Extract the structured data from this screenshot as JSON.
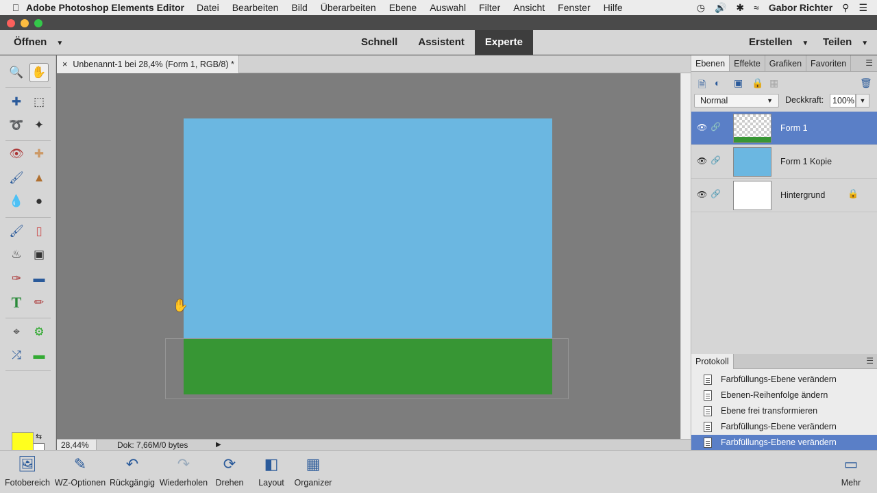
{
  "menubar": {
    "app_name": "Adobe Photoshop Elements Editor",
    "items": [
      "Datei",
      "Bearbeiten",
      "Bild",
      "Überarbeiten",
      "Ebene",
      "Auswahl",
      "Filter",
      "Ansicht",
      "Fenster",
      "Hilfe"
    ],
    "user": "Gabor Richter"
  },
  "modebar": {
    "open_label": "Öffnen",
    "modes": [
      "Schnell",
      "Assistent",
      "Experte"
    ],
    "active_mode": "Experte",
    "create_label": "Erstellen",
    "share_label": "Teilen"
  },
  "document": {
    "tab_close": "×",
    "tab_title": "Unbenannt-1 bei 28,4% (Form 1, RGB/8) *",
    "sky_color": "#6bb7e1",
    "grass_color": "#379634"
  },
  "status": {
    "zoom": "28,44%",
    "doc_info": "Dok: 7,66M/0 bytes"
  },
  "colors": {
    "foreground": "#ffff1e",
    "background": "#ffffff"
  },
  "layers_panel": {
    "tabs": [
      "Ebenen",
      "Effekte",
      "Grafiken",
      "Favoriten"
    ],
    "active_tab": "Ebenen",
    "blend_mode": "Normal",
    "opacity_label": "Deckkraft:",
    "opacity_value": "100%",
    "layers": [
      {
        "name": "Form 1",
        "selected": true
      },
      {
        "name": "Form 1 Kopie",
        "selected": false
      },
      {
        "name": "Hintergrund",
        "selected": false
      }
    ]
  },
  "history_panel": {
    "tab": "Protokoll",
    "items": [
      "Farbfüllungs-Ebene verändern",
      "Ebenen-Reihenfolge ändern",
      "Ebene frei transformieren",
      "Farbfüllungs-Ebene verändern",
      "Farbfüllungs-Ebene verändern"
    ]
  },
  "taskbar": {
    "items": [
      "Fotobereich",
      "WZ-Optionen",
      "Rückgängig",
      "Wiederholen",
      "Drehen",
      "Layout",
      "Organizer"
    ],
    "more_label": "Mehr"
  }
}
